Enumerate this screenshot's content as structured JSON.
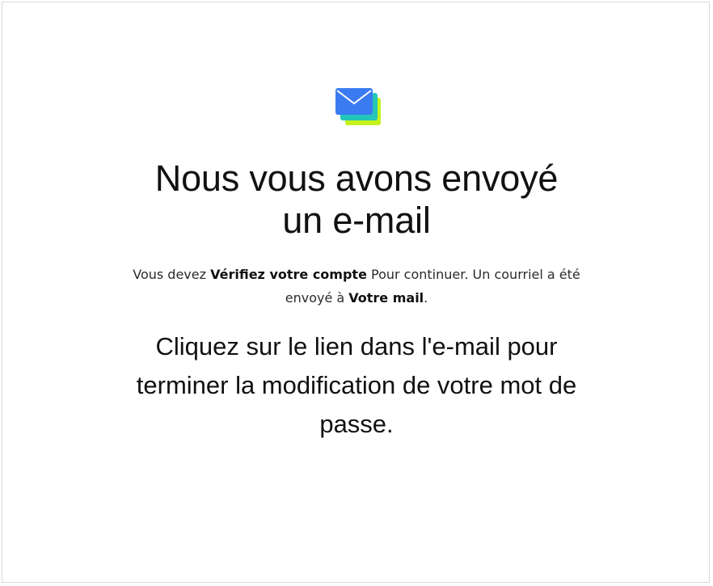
{
  "icon": {
    "name": "envelope-stack-icon",
    "colors": {
      "front": "#3b7bf2",
      "middle": "#23c6b7",
      "back": "#c6f21e"
    }
  },
  "heading": {
    "line1": "Nous vous avons envoyé",
    "line2": "un e-mail"
  },
  "message": {
    "part1": "Vous devez ",
    "bold1": "Vérifiez votre compte",
    "part2": " Pour continuer. Un courriel a été envoyé à ",
    "bold2": "Votre mail",
    "part3": "."
  },
  "instructions": "Cliquez sur le lien dans l'e-mail pour terminer la modification de votre mot de passe."
}
